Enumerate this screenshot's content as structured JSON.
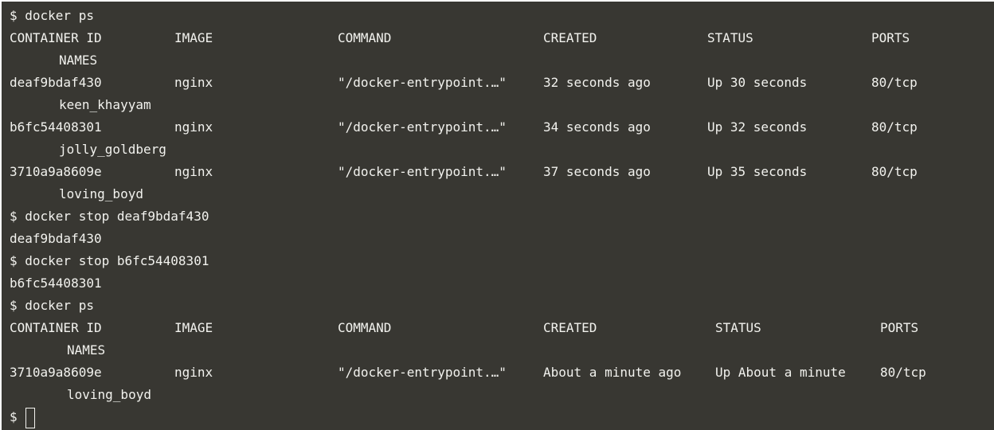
{
  "terminal": {
    "lines": [
      {
        "type": "prompt",
        "text": "$ docker ps"
      },
      {
        "type": "row",
        "cells": [
          "CONTAINER ID",
          "IMAGE",
          "COMMAND",
          "CREATED",
          "STATUS",
          "PORTS"
        ]
      },
      {
        "type": "name",
        "text": "NAMES"
      },
      {
        "type": "row",
        "cells": [
          "deaf9bdaf430",
          "nginx",
          "\"/docker-entrypoint.…\"",
          "32 seconds ago",
          "Up 30 seconds",
          "80/tcp"
        ]
      },
      {
        "type": "name",
        "text": "keen_khayyam"
      },
      {
        "type": "row",
        "cells": [
          "b6fc54408301",
          "nginx",
          "\"/docker-entrypoint.…\"",
          "34 seconds ago",
          "Up 32 seconds",
          "80/tcp"
        ]
      },
      {
        "type": "name",
        "text": "jolly_goldberg"
      },
      {
        "type": "row",
        "cells": [
          "3710a9a8609e",
          "nginx",
          "\"/docker-entrypoint.…\"",
          "37 seconds ago",
          "Up 35 seconds",
          "80/tcp"
        ]
      },
      {
        "type": "name",
        "text": "loving_boyd"
      },
      {
        "type": "prompt",
        "text": "$ docker stop deaf9bdaf430"
      },
      {
        "type": "output",
        "text": "deaf9bdaf430"
      },
      {
        "type": "prompt",
        "text": "$ docker stop b6fc54408301"
      },
      {
        "type": "output",
        "text": "b6fc54408301"
      },
      {
        "type": "prompt",
        "text": "$ docker ps"
      },
      {
        "type": "row2",
        "cells": [
          "CONTAINER ID",
          "IMAGE",
          "COMMAND",
          "CREATED",
          "STATUS",
          "PORTS"
        ]
      },
      {
        "type": "name2",
        "text": "NAMES"
      },
      {
        "type": "row2",
        "cells": [
          "3710a9a8609e",
          "nginx",
          "\"/docker-entrypoint.…\"",
          "About a minute ago",
          "Up About a minute",
          "80/tcp"
        ]
      },
      {
        "type": "name2",
        "text": "loving_boyd"
      },
      {
        "type": "cursor",
        "text": "$"
      }
    ]
  }
}
